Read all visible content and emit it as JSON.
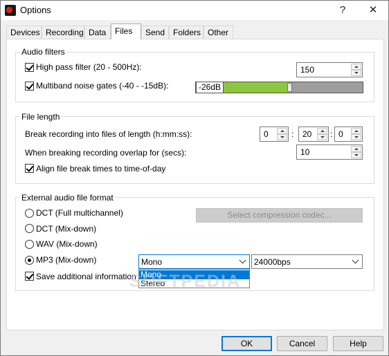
{
  "window": {
    "title": "Options",
    "help_glyph": "?",
    "close_glyph": "✕"
  },
  "tabs": [
    "Devices",
    "Recording",
    "Data",
    "Files",
    "Send",
    "Folders",
    "Other"
  ],
  "active_tab": "Files",
  "audio_filters": {
    "title": "Audio filters",
    "high_pass": {
      "label": "High pass filter (20 - 500Hz):",
      "checked": true,
      "value": "150"
    },
    "multiband": {
      "label": "Multiband noise gates (-40 - -15dB):",
      "checked": true,
      "value": "-26dB",
      "level_fraction": 0.56
    }
  },
  "file_length": {
    "title": "File length",
    "break_label": "Break recording into files of length (h:mm:ss):",
    "hours": "0",
    "minutes": "20",
    "seconds": "0",
    "separator": ":",
    "overlap_label": "When breaking recording overlap for (secs):",
    "overlap_value": "10",
    "align_label": "Align file break times to time-of-day",
    "align_checked": true
  },
  "external_format": {
    "title": "External audio file format",
    "options": [
      {
        "label": "DCT (Full multichannel)",
        "selected": false
      },
      {
        "label": "DCT (Mix-down)",
        "selected": false
      },
      {
        "label": "WAV (Mix-down)",
        "selected": false
      },
      {
        "label": "MP3 (Mix-down)",
        "selected": true
      }
    ],
    "codec_button": "Select compression codec...",
    "channel_select": {
      "value": "Mono",
      "options": [
        "Mono",
        "Stereo"
      ],
      "highlighted": "Mono"
    },
    "bitrate_select": {
      "value": "24000bps"
    },
    "save_additional": {
      "label": "Save additional information and",
      "checked": true
    }
  },
  "watermark": "SOFTPEDIA",
  "buttons": {
    "ok": "OK",
    "cancel": "Cancel",
    "help": "Help"
  },
  "colors": {
    "accent": "#0078d7",
    "level_fill": "#8dc63f",
    "level_track": "#9e9e9e",
    "disabled_button": "#cccccc"
  }
}
